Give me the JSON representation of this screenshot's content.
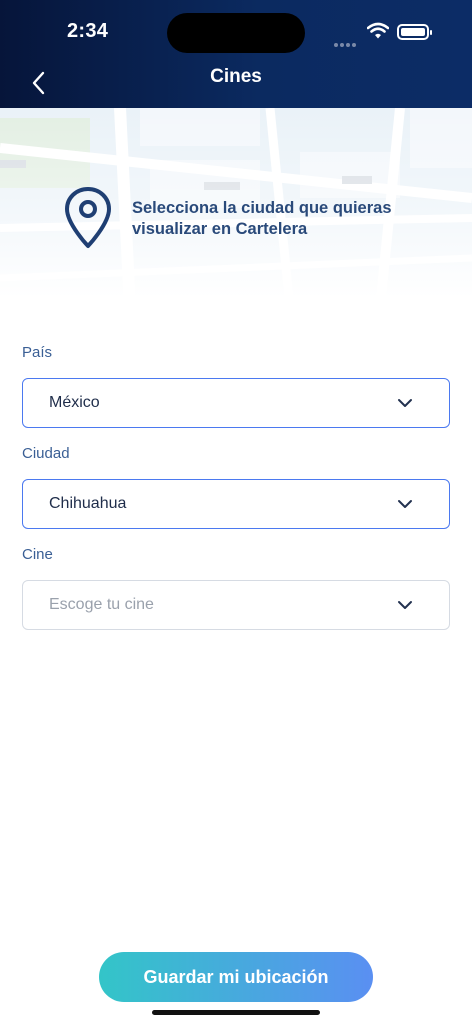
{
  "status_bar": {
    "time": "2:34"
  },
  "header": {
    "title": "Cines",
    "back_icon": "chevron-left-icon"
  },
  "banner": {
    "text": "Selecciona la ciudad que quieras visualizar en Cartelera",
    "icon": "location-pin-icon"
  },
  "fields": [
    {
      "label": "País",
      "value": "México",
      "placeholder": ""
    },
    {
      "label": "Ciudad",
      "value": "Chihuahua",
      "placeholder": ""
    },
    {
      "label": "Cine",
      "value": "",
      "placeholder": "Escoge tu cine"
    }
  ],
  "cine_display": "Escoge tu cine",
  "save_button": {
    "label": "Guardar mi ubicación"
  },
  "colors": {
    "header": "#0b2a60",
    "accent_border": "#4b79f0",
    "button_start": "#33c5c8",
    "button_end": "#5a8ff2",
    "label": "#3a5f95"
  }
}
